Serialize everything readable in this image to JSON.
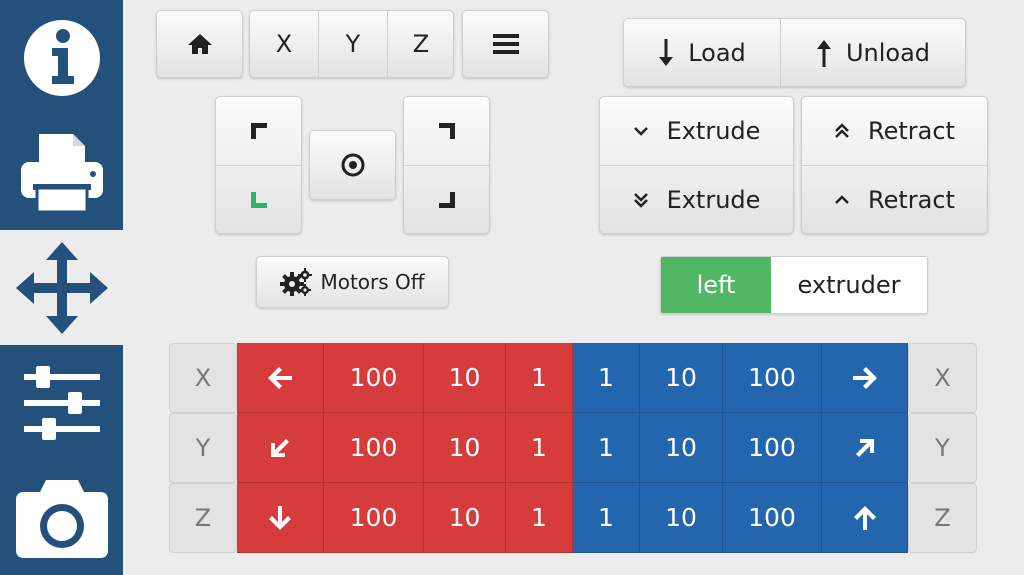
{
  "sidebar": {
    "items": [
      {
        "icon": "info-icon",
        "active": false
      },
      {
        "icon": "printer-icon",
        "active": false
      },
      {
        "icon": "move-arrows-icon",
        "active": true
      },
      {
        "icon": "sliders-icon",
        "active": false
      },
      {
        "icon": "camera-icon",
        "active": false
      }
    ]
  },
  "home_axes": {
    "x": "X",
    "y": "Y",
    "z": "Z"
  },
  "filament": {
    "load": "Load",
    "unload": "Unload"
  },
  "extrude": {
    "extrude_small": "Extrude",
    "retract_small": "Retract",
    "extrude_large": "Extrude",
    "retract_large": "Retract"
  },
  "motors_off": "Motors Off",
  "extruder_toggle": {
    "left": "left",
    "right": "extruder",
    "selected": "left"
  },
  "jog": {
    "rows": [
      {
        "axis": "X",
        "minus": [
          "100",
          "10",
          "1"
        ],
        "plus": [
          "1",
          "10",
          "100"
        ]
      },
      {
        "axis": "Y",
        "minus": [
          "100",
          "10",
          "1"
        ],
        "plus": [
          "1",
          "10",
          "100"
        ]
      },
      {
        "axis": "Z",
        "minus": [
          "100",
          "10",
          "1"
        ],
        "plus": [
          "1",
          "10",
          "100"
        ]
      }
    ]
  },
  "colors": {
    "sidebar_dark": "#24507c",
    "minus": "#d63c3c",
    "plus": "#2466ad",
    "toggle_on": "#52b765",
    "corner_active": "#2db36a"
  }
}
